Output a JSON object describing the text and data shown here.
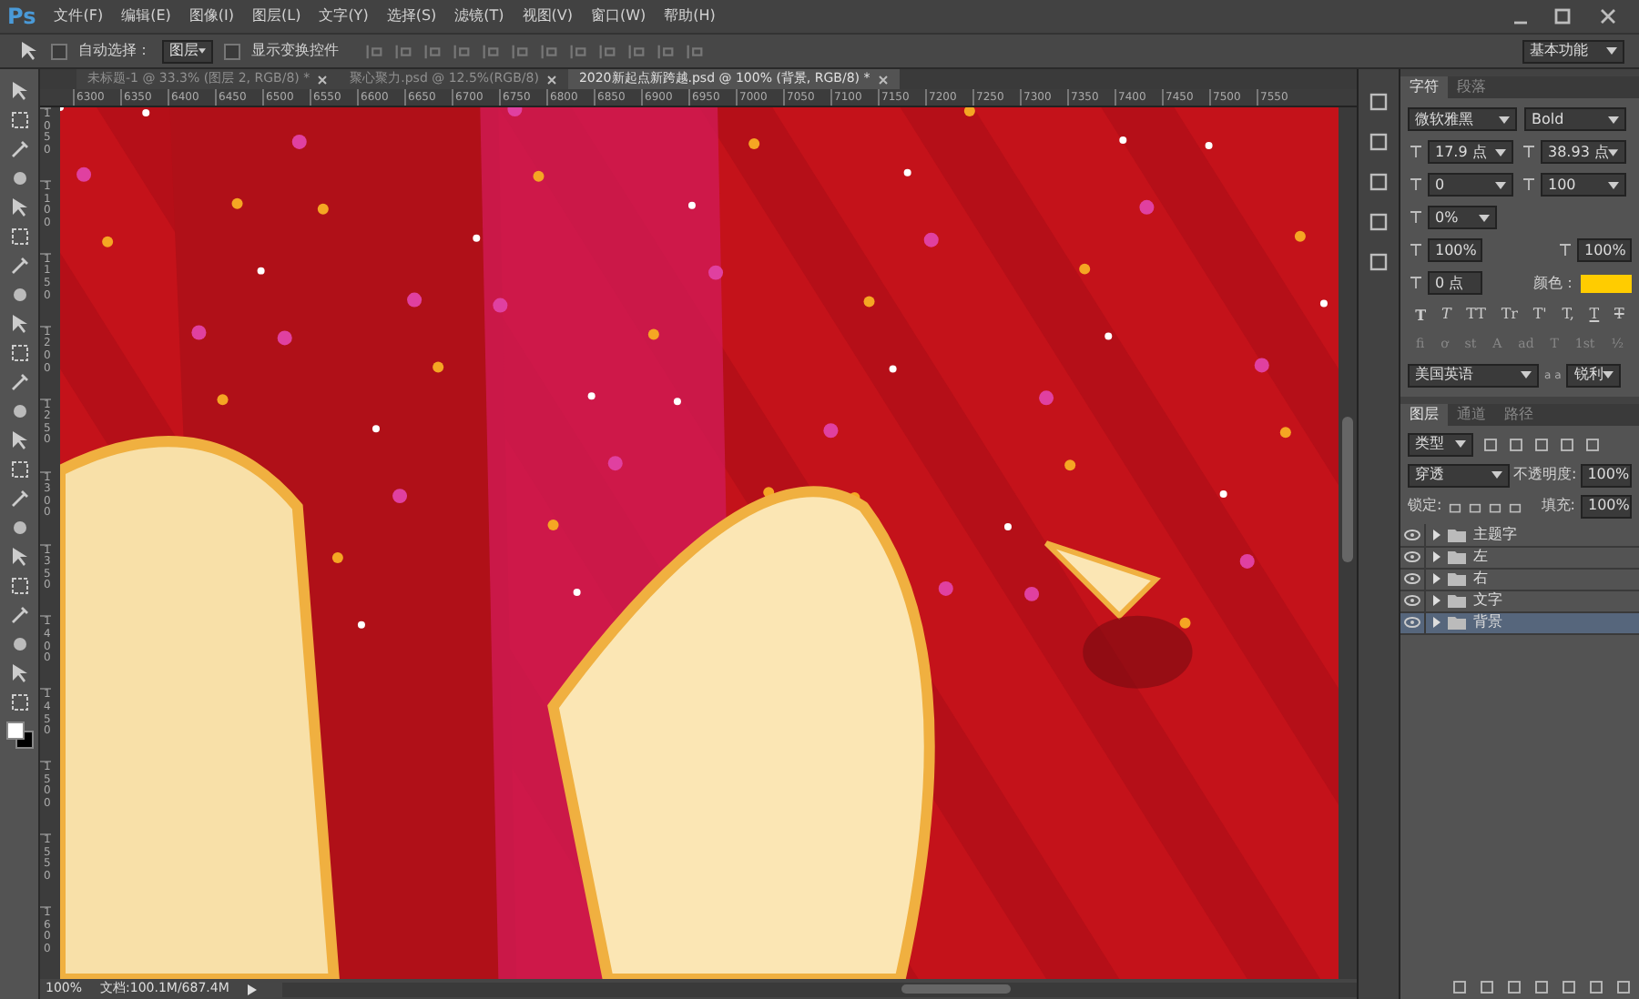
{
  "app": {
    "logo": "Ps"
  },
  "menu": [
    "文件(F)",
    "编辑(E)",
    "图像(I)",
    "图层(L)",
    "文字(Y)",
    "选择(S)",
    "滤镜(T)",
    "视图(V)",
    "窗口(W)",
    "帮助(H)"
  ],
  "options": {
    "auto_select": {
      "label": "自动选择：",
      "checked": false
    },
    "auto_select_target": "图层",
    "show_transform": {
      "label": "显示变换控件",
      "checked": false
    },
    "workspace": "基本功能"
  },
  "doc_tabs": [
    {
      "label": "未标题-1 @ 33.3% (图层 2, RGB/8) *",
      "selected": false
    },
    {
      "label": "聚心聚力.psd @ 12.5%(RGB/8)",
      "selected": false
    },
    {
      "label": "2020新起点新跨越.psd @ 100% (背景, RGB/8) *",
      "selected": true
    }
  ],
  "ruler_h": [
    "6300",
    "6350",
    "6400",
    "6450",
    "6500",
    "6550",
    "6600",
    "6650",
    "6700",
    "6750",
    "6800",
    "6850",
    "6900",
    "6950",
    "7000",
    "7050",
    "7100",
    "7150",
    "7200",
    "7250",
    "7300",
    "7350",
    "7400",
    "7450",
    "7500",
    "7550"
  ],
  "ruler_v": [
    "1050",
    "1100",
    "1150",
    "1200",
    "1250",
    "1300",
    "1350",
    "1400",
    "1450",
    "1500",
    "1550",
    "1600"
  ],
  "character_panel": {
    "tabs": [
      {
        "label": "字符",
        "selected": true
      },
      {
        "label": "段落",
        "selected": false
      }
    ],
    "font": "微软雅黑",
    "style": "Bold",
    "size": "17.9 点",
    "leading": "38.93 点",
    "kerning": "0",
    "tracking": "100",
    "tsume": "0%",
    "vertical_scale": "100%",
    "horizontal_scale": "100%",
    "baseline_shift": "0 点",
    "color_label": "颜色：",
    "color": "#ffcc00",
    "styles": [
      {
        "glyph": "T",
        "kind": "bold"
      },
      {
        "glyph": "T",
        "kind": "italic"
      },
      {
        "glyph": "TT",
        "kind": "plain"
      },
      {
        "glyph": "Tr",
        "kind": "plain"
      },
      {
        "glyph": "T'",
        "kind": "plain"
      },
      {
        "glyph": "T,",
        "kind": "plain"
      },
      {
        "glyph": "T",
        "kind": "underline"
      },
      {
        "glyph": "T",
        "kind": "strike"
      }
    ],
    "opentype": [
      "fi",
      "ơ",
      "st",
      "A",
      "ad",
      "T",
      "1st",
      "½"
    ],
    "language": "美国英语",
    "aa_glyph": "a a",
    "antialias": "锐利"
  },
  "layers_panel": {
    "tabs": [
      {
        "label": "图层",
        "selected": true
      },
      {
        "label": "通道",
        "selected": false
      },
      {
        "label": "路径",
        "selected": false
      }
    ],
    "filter": "类型",
    "blend": "穿透",
    "opacity_label": "不透明度:",
    "opacity": "100%",
    "lock_label": "锁定:",
    "fill_label": "填充:",
    "fill": "100%",
    "layers": [
      {
        "name": "主题字",
        "visible": true,
        "selected": false
      },
      {
        "name": "左",
        "visible": true,
        "selected": false
      },
      {
        "name": "右",
        "visible": true,
        "selected": false
      },
      {
        "name": "文字",
        "visible": true,
        "selected": false
      },
      {
        "name": "背景",
        "visible": true,
        "selected": true
      }
    ]
  },
  "status_bar": {
    "zoom": "100%",
    "doc_size": "文档:100.1M/687.4M"
  }
}
